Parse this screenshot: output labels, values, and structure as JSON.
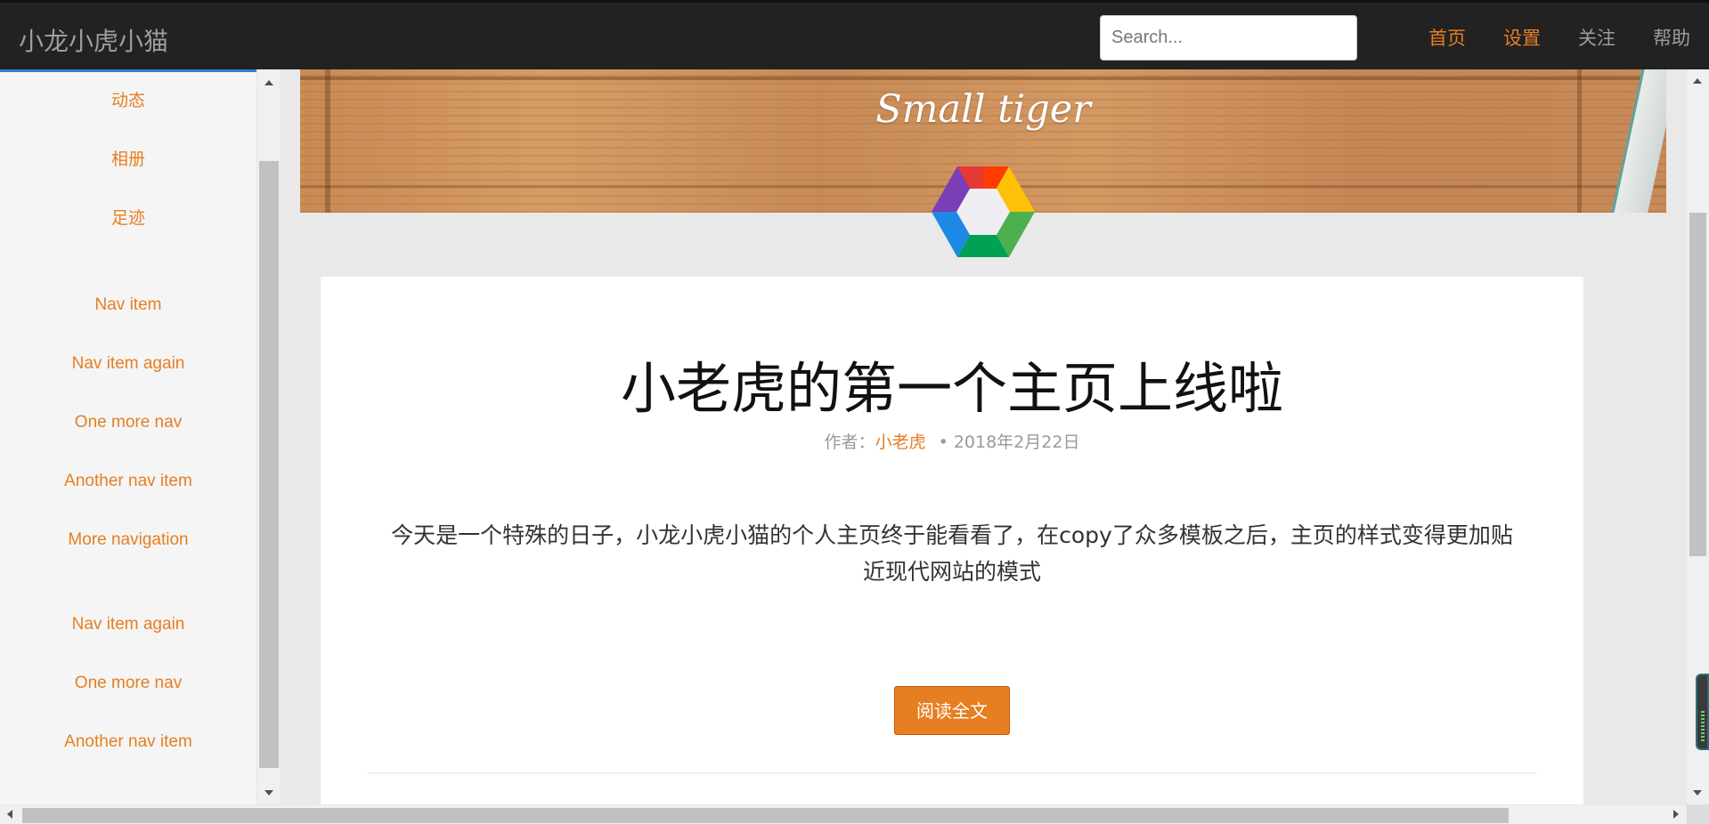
{
  "navbar": {
    "brand": "小龙小虎小猫",
    "search_placeholder": "Search...",
    "links": [
      {
        "label": "首页",
        "active": true
      },
      {
        "label": "设置",
        "active": true
      },
      {
        "label": "关注",
        "active": false
      },
      {
        "label": "帮助",
        "active": false
      }
    ]
  },
  "sidebar": {
    "group1": [
      "动态",
      "相册",
      "足迹"
    ],
    "group2": [
      "Nav item",
      "Nav item again",
      "One more nav",
      "Another nav item",
      "More navigation"
    ],
    "group3": [
      "Nav item again",
      "One more nav",
      "Another nav item"
    ]
  },
  "banner": {
    "title": "Small tiger"
  },
  "post": {
    "title": "小老虎的第一个主页上线啦",
    "author_prefix": "作者：",
    "author": "小老虎",
    "date": "• 2018年2月22日",
    "body": "今天是一个特殊的日子，小龙小虎小猫的个人主页终于能看看了，在copy了众多模板之后，主页的样式变得更加贴近现代网站的模式",
    "read_more": "阅读全文"
  },
  "colors": {
    "accent": "#e67e22",
    "navbar_bg": "#222222",
    "sidebar_bg": "#f5f5f5",
    "main_bg": "#e9e9e9"
  },
  "icons": [
    "hexagon-logo-icon",
    "scroll-up-arrow-icon",
    "scroll-down-arrow-icon",
    "scroll-left-arrow-icon",
    "scroll-right-arrow-icon"
  ]
}
